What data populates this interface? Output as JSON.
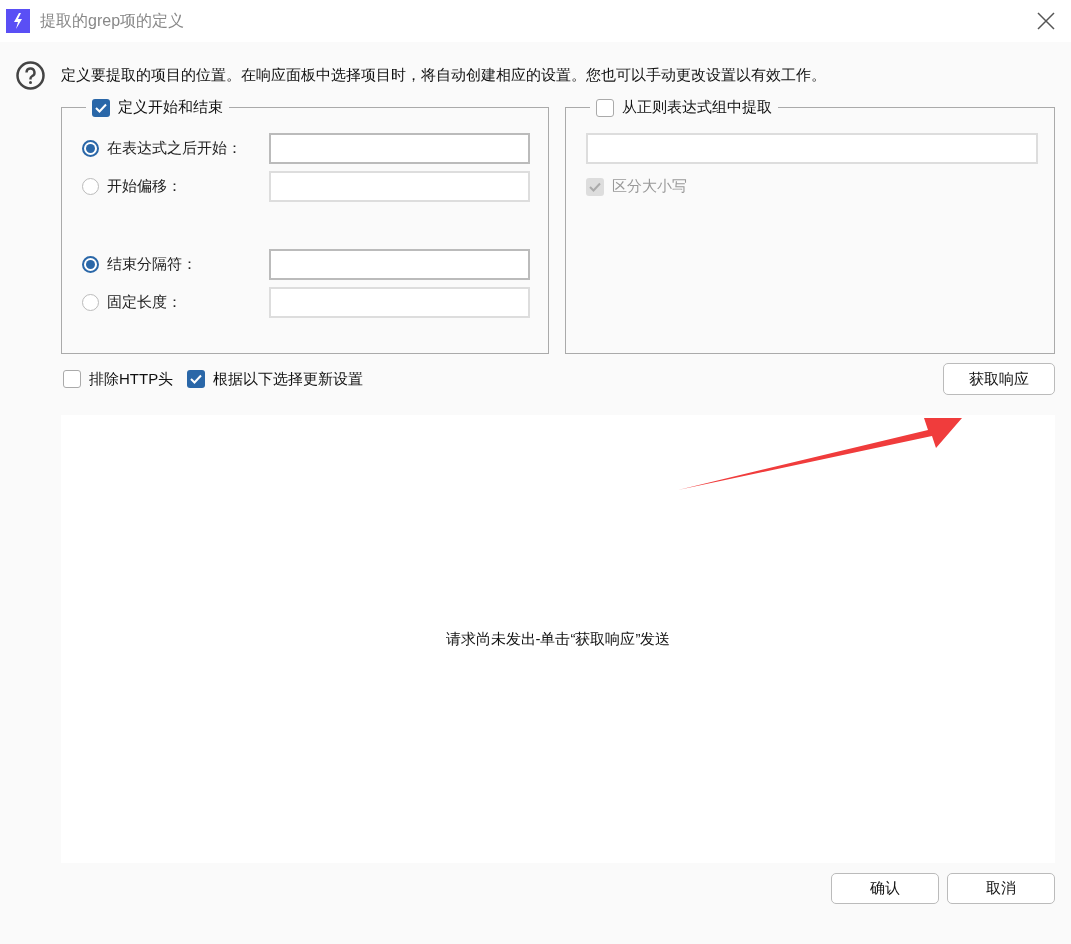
{
  "window": {
    "title": "提取的grep项的定义"
  },
  "info": "定义要提取的项目的位置。在响应面板中选择项目时，将自动创建相应的设置。您也可以手动更改设置以有效工作。",
  "define_start_end": {
    "label": "定义开始和结束",
    "checked": true,
    "start_options": [
      {
        "label": "在表达式之后开始：",
        "selected": true
      },
      {
        "label": "开始偏移：",
        "selected": false
      }
    ],
    "end_options": [
      {
        "label": "结束分隔符：",
        "selected": true
      },
      {
        "label": "固定长度：",
        "selected": false
      }
    ]
  },
  "regex_group": {
    "label": "从正则表达式组中提取",
    "checked": false,
    "case_sensitive": {
      "label": "区分大小写",
      "checked": true,
      "disabled": true
    }
  },
  "options": [
    {
      "label": "排除HTTP头",
      "checked": false
    },
    {
      "label": "根据以下选择更新设置",
      "checked": true
    }
  ],
  "fetch_button": "获取响应",
  "response_message": "请求尚未发出-单击“获取响应”发送",
  "buttons": [
    "确认",
    "取消"
  ]
}
